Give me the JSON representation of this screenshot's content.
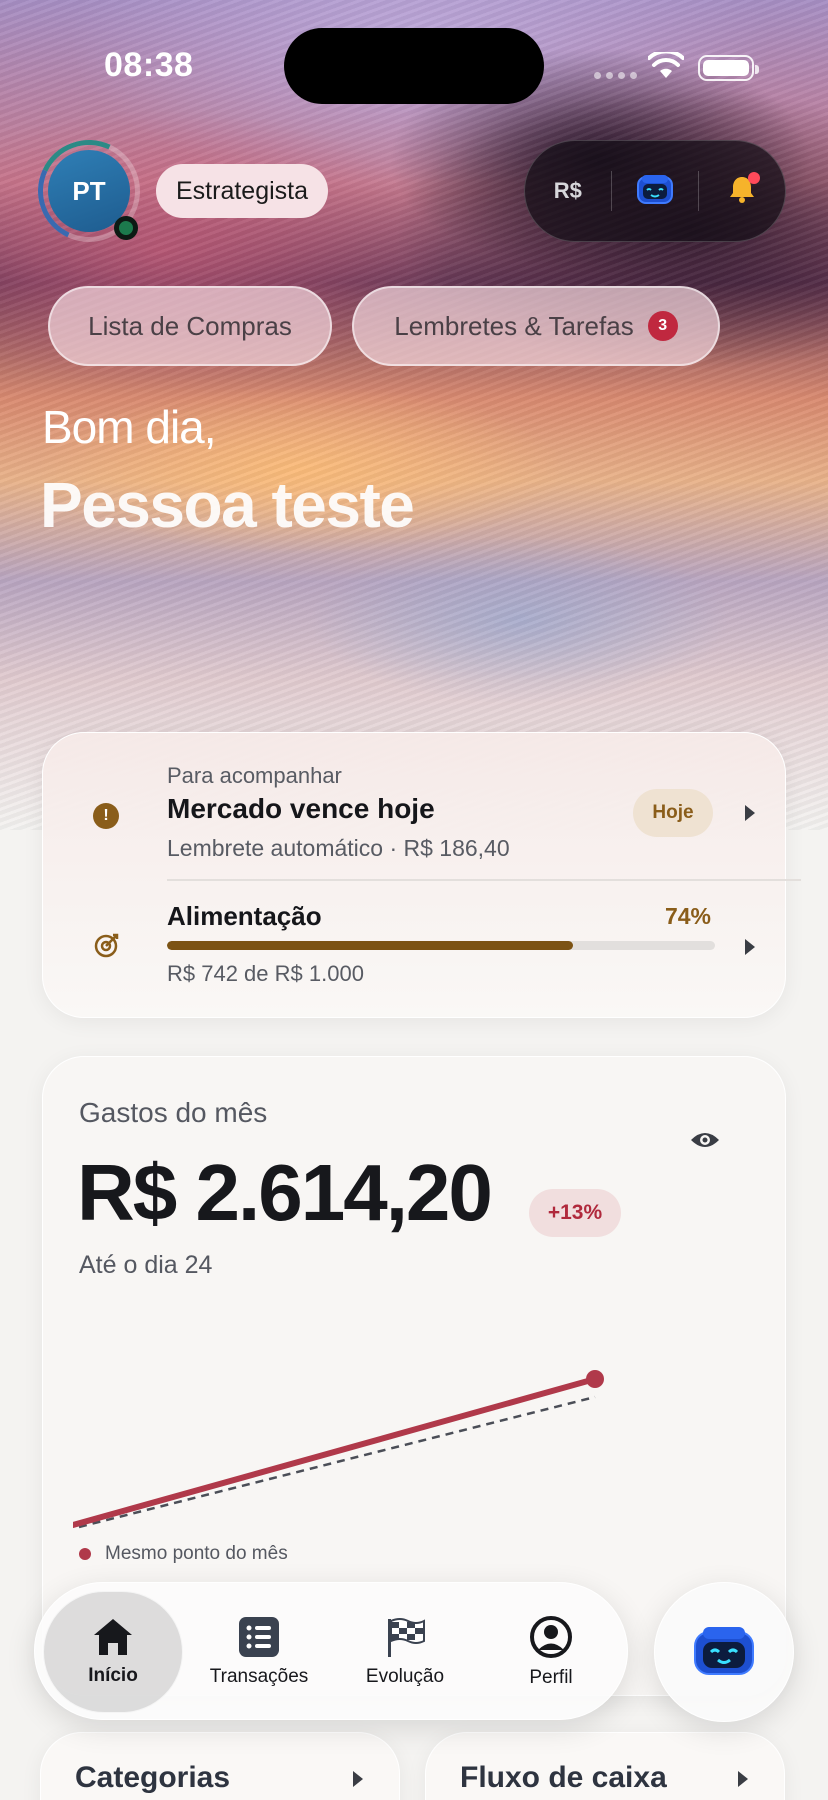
{
  "status_bar": {
    "time": "08:38"
  },
  "header": {
    "avatar_initials": "PT",
    "role_badge": "Estrategista",
    "currency_label": "R$"
  },
  "chips": [
    {
      "label": "Lista de Compras"
    },
    {
      "label": "Lembretes & Tarefas",
      "count": "3"
    }
  ],
  "greeting": {
    "line1": "Bom dia,",
    "name": "Pessoa teste"
  },
  "follow_up": {
    "overline": "Para acompanhar",
    "title": "Mercado vence hoje",
    "subtitle": "Lembrete automático · R$ 186,40",
    "pill": "Hoje",
    "budget_name": "Alimentação",
    "budget_pct_label": "74%",
    "budget_progress": 0.74,
    "budget_sub": "R$ 742 de R$ 1.000"
  },
  "spending": {
    "label": "Gastos do mês",
    "amount": "R$ 2.614,20",
    "delta": "+13%",
    "subtitle": "Até o dia 24",
    "legend": "Mesmo ponto do mês"
  },
  "bottom_cards": [
    {
      "title": "Categorias"
    },
    {
      "title": "Fluxo de caixa"
    }
  ],
  "tabbar": {
    "items": [
      {
        "label": "Início",
        "icon": "home-icon"
      },
      {
        "label": "Transações",
        "icon": "list-icon"
      },
      {
        "label": "Evolução",
        "icon": "checkered-flag-icon"
      },
      {
        "label": "Perfil",
        "icon": "user-circle-icon"
      }
    ]
  },
  "colors": {
    "accent_red": "#b0394a",
    "accent_gold": "#8a5d1a",
    "avatar_blue": "#2f7fb6"
  }
}
